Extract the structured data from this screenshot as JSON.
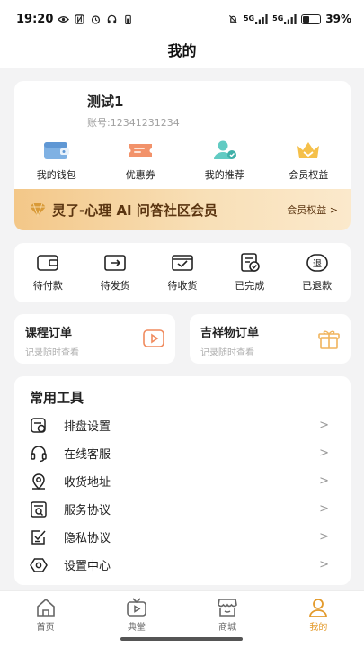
{
  "status_bar": {
    "time": "19:20",
    "battery_percent": "39%",
    "network_1": "5G",
    "network_2": "5G"
  },
  "header": {
    "title": "我的"
  },
  "profile": {
    "name": "测试1",
    "account": "账号:12341231234"
  },
  "quick_actions": [
    {
      "label": "我的钱包",
      "icon": "wallet-icon"
    },
    {
      "label": "优惠券",
      "icon": "coupon-icon"
    },
    {
      "label": "我的推荐",
      "icon": "referral-icon"
    },
    {
      "label": "会员权益",
      "icon": "crown-icon"
    }
  ],
  "vip_banner": {
    "title": "灵了-心理 AI 问答社区会员",
    "link": "会员权益 >"
  },
  "orders": [
    {
      "label": "待付款",
      "icon": "wallet-pay-icon"
    },
    {
      "label": "待发货",
      "icon": "ship-box-icon"
    },
    {
      "label": "待收货",
      "icon": "receive-check-icon"
    },
    {
      "label": "已完成",
      "icon": "document-check-icon"
    },
    {
      "label": "已退款",
      "icon": "refund-icon"
    }
  ],
  "course_orders": {
    "title": "课程订单",
    "subtitle": "记录随时查看"
  },
  "mascot_orders": {
    "title": "吉祥物订单",
    "subtitle": "记录随时查看"
  },
  "tools": {
    "title": "常用工具",
    "chevron": ">",
    "items": [
      {
        "label": "排盘设置",
        "icon": "chart-settings-icon"
      },
      {
        "label": "在线客服",
        "icon": "headset-icon"
      },
      {
        "label": "收货地址",
        "icon": "location-icon"
      },
      {
        "label": "服务协议",
        "icon": "service-agreement-icon"
      },
      {
        "label": "隐私协议",
        "icon": "privacy-agreement-icon"
      },
      {
        "label": "设置中心",
        "icon": "settings-icon"
      }
    ]
  },
  "bottom_nav": [
    {
      "label": "首页",
      "icon": "home-icon",
      "active": false
    },
    {
      "label": "典堂",
      "icon": "tv-icon",
      "active": false
    },
    {
      "label": "商城",
      "icon": "store-icon",
      "active": false
    },
    {
      "label": "我的",
      "icon": "user-icon",
      "active": true
    }
  ],
  "colors": {
    "accent": "#e39a2b",
    "vip_text": "#5a3410",
    "wallet": "#6fa8dc",
    "coupon": "#f08a5d",
    "referral": "#5ec8c0"
  }
}
